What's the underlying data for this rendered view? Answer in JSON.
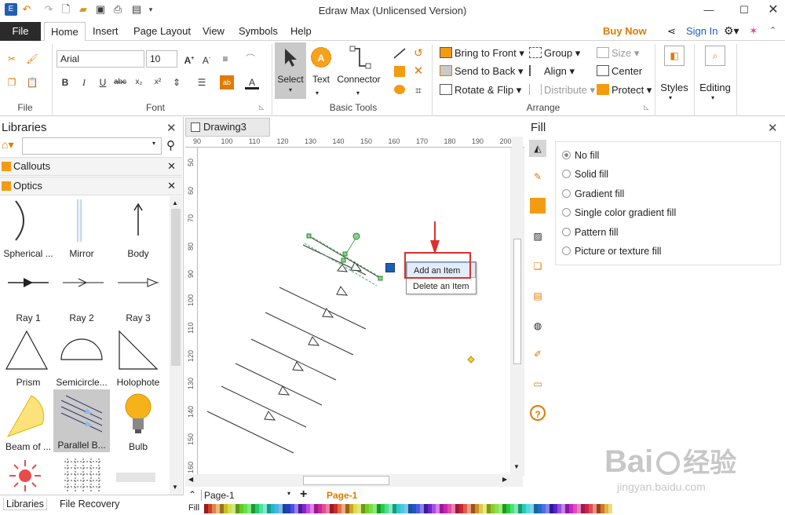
{
  "window": {
    "title": "Edraw Max (Unlicensed Version)"
  },
  "menu": {
    "file": "File",
    "tabs": [
      "Home",
      "Insert",
      "Page Layout",
      "View",
      "Symbols",
      "Help"
    ],
    "buy_now": "Buy Now",
    "sign_in": "Sign In"
  },
  "ribbon": {
    "file_group": "File",
    "font_group": "Font",
    "font_name": "Arial",
    "font_size": "10",
    "basic_tools_group": "Basic Tools",
    "select": "Select",
    "text": "Text",
    "connector": "Connector",
    "arrange_group": "Arrange",
    "bring_to_front": "Bring to Front",
    "send_to_back": "Send to Back",
    "rotate_flip": "Rotate & Flip",
    "group": "Group",
    "align": "Align",
    "distribute": "Distribute",
    "size": "Size",
    "center": "Center",
    "protect": "Protect",
    "styles": "Styles",
    "editing": "Editing"
  },
  "libraries": {
    "title": "Libraries",
    "search_placeholder": "",
    "sections": [
      "Callouts",
      "Optics"
    ],
    "shapes": [
      "Spherical ...",
      "Mirror",
      "Body",
      "Ray 1",
      "Ray 2",
      "Ray 3",
      "Prism",
      "Semicircle...",
      "Holophote",
      "Beam of ...",
      "Parallel B...",
      "Bulb"
    ],
    "bottom_tabs": [
      "Libraries",
      "File Recovery"
    ]
  },
  "document": {
    "tab": "Drawing3",
    "ruler_h": [
      "90",
      "100",
      "110",
      "120",
      "130",
      "140",
      "150",
      "160",
      "170",
      "180",
      "190",
      "200"
    ],
    "ruler_v": [
      "50",
      "60",
      "70",
      "80",
      "90",
      "100",
      "110",
      "120",
      "130",
      "140",
      "150",
      "160"
    ]
  },
  "context_menu": {
    "items": [
      "Add an Item",
      "Delete an Item"
    ]
  },
  "fill_panel": {
    "title": "Fill",
    "options": [
      "No fill",
      "Solid fill",
      "Gradient fill",
      "Single color gradient fill",
      "Pattern fill",
      "Picture or texture fill"
    ],
    "selected": "No fill"
  },
  "pagebar": {
    "page_select": "Page-1",
    "page_tab": "Page-1",
    "fill_label": "Fill"
  },
  "watermark": {
    "brand": "Bai",
    "brand2": "经验",
    "url": "jingyan.baidu.com"
  },
  "colors": {
    "accent_orange": "#e07b00",
    "highlight_red": "#d9322c",
    "selection_green": "#3cb04a",
    "file_tab": "#2b2b2b"
  }
}
